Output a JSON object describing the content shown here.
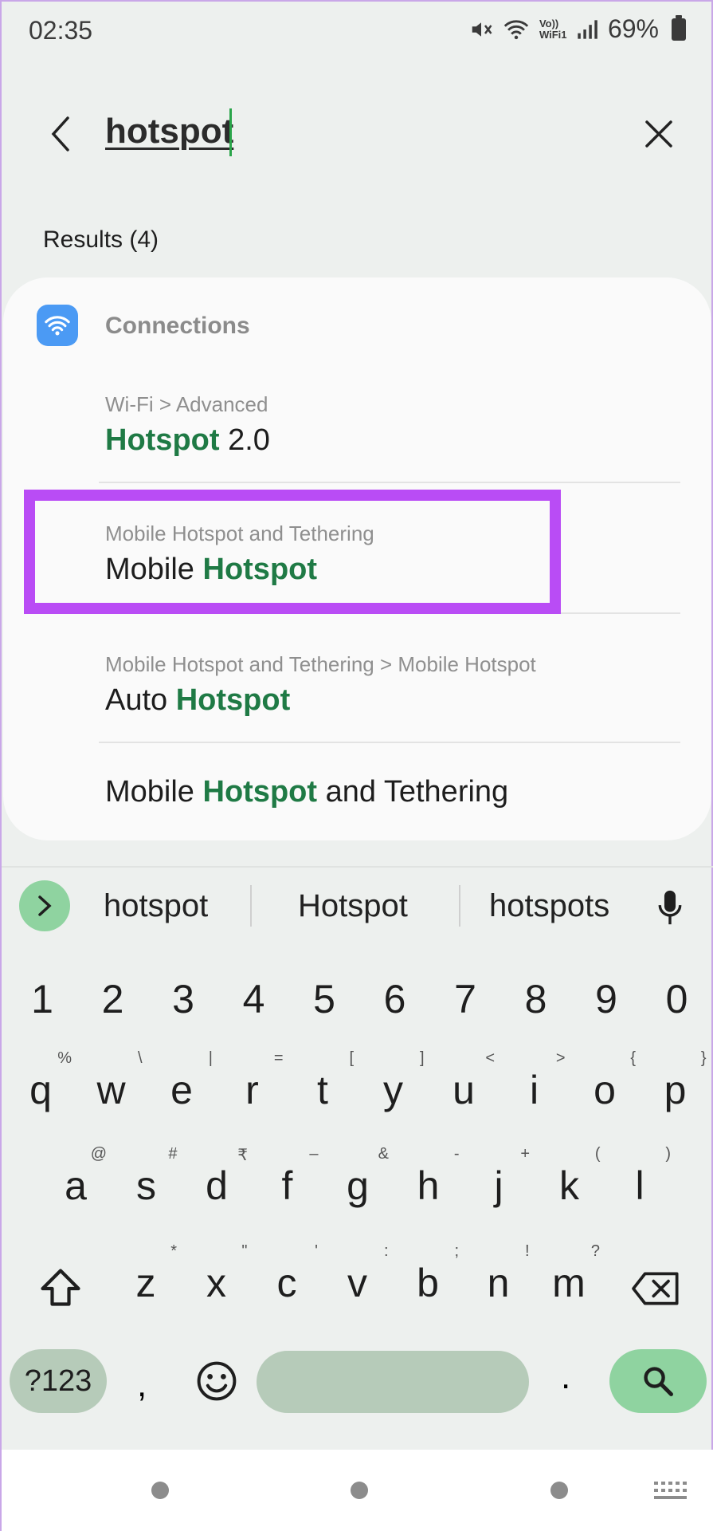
{
  "status_bar": {
    "time": "02:35",
    "battery": "69%",
    "icons": [
      "mute-icon",
      "wifi-icon",
      "volte-wifi-icon",
      "signal-icon",
      "battery-icon"
    ],
    "volte_label": "Vo)) WiFi1"
  },
  "search": {
    "query": "hotspot",
    "back_icon": "back-arrow-icon",
    "clear_icon": "close-icon"
  },
  "results": {
    "count_label": "Results (4)",
    "category": {
      "label": "Connections",
      "icon": "wifi-icon",
      "color": "#4b9af4"
    },
    "items": [
      {
        "path": "Wi-Fi > Advanced",
        "title_pre": "",
        "title_hl": "Hotspot",
        "title_post": " 2.0"
      },
      {
        "path": "Mobile Hotspot and Tethering",
        "title_pre": "Mobile ",
        "title_hl": "Hotspot",
        "title_post": ""
      },
      {
        "path": "Mobile Hotspot and Tethering > Mobile Hotspot",
        "title_pre": "Auto ",
        "title_hl": "Hotspot",
        "title_post": ""
      },
      {
        "path": "",
        "title_pre": "Mobile ",
        "title_hl": "Hotspot",
        "title_post": " and Tethering"
      }
    ],
    "highlight_color": "#1f7a45",
    "annotation_color": "#b94cf5"
  },
  "keyboard": {
    "suggestions": [
      "hotspot",
      "Hotspot",
      "hotspots"
    ],
    "number_row": [
      "1",
      "2",
      "3",
      "4",
      "5",
      "6",
      "7",
      "8",
      "9",
      "0"
    ],
    "row1": [
      {
        "k": "q",
        "s": "%"
      },
      {
        "k": "w",
        "s": "\\"
      },
      {
        "k": "e",
        "s": "|"
      },
      {
        "k": "r",
        "s": "="
      },
      {
        "k": "t",
        "s": "["
      },
      {
        "k": "y",
        "s": "]"
      },
      {
        "k": "u",
        "s": "<"
      },
      {
        "k": "i",
        "s": ">"
      },
      {
        "k": "o",
        "s": "{"
      },
      {
        "k": "p",
        "s": "}"
      }
    ],
    "row2": [
      {
        "k": "a",
        "s": "@"
      },
      {
        "k": "s",
        "s": "#"
      },
      {
        "k": "d",
        "s": "₹"
      },
      {
        "k": "f",
        "s": "–"
      },
      {
        "k": "g",
        "s": "&"
      },
      {
        "k": "h",
        "s": "-"
      },
      {
        "k": "j",
        "s": "+"
      },
      {
        "k": "k",
        "s": "("
      },
      {
        "k": "l",
        "s": ")"
      }
    ],
    "row3": [
      {
        "k": "z",
        "s": "*"
      },
      {
        "k": "x",
        "s": "\""
      },
      {
        "k": "c",
        "s": "'"
      },
      {
        "k": "v",
        "s": ":"
      },
      {
        "k": "b",
        "s": ";"
      },
      {
        "k": "n",
        "s": "!"
      },
      {
        "k": "m",
        "s": "?"
      }
    ],
    "symbols_label": "?123",
    "comma": ",",
    "period": ".",
    "accent_color": "#8fd3a0"
  }
}
